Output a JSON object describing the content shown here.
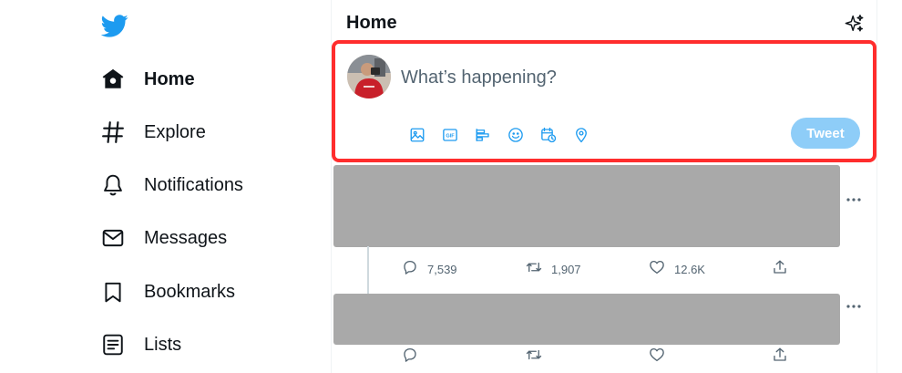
{
  "sidebar": {
    "logo": "twitter-bird-icon",
    "items": [
      {
        "label": "Home",
        "icon": "home-icon",
        "active": true
      },
      {
        "label": "Explore",
        "icon": "hashtag-icon"
      },
      {
        "label": "Notifications",
        "icon": "bell-icon"
      },
      {
        "label": "Messages",
        "icon": "envelope-icon"
      },
      {
        "label": "Bookmarks",
        "icon": "bookmark-icon"
      },
      {
        "label": "Lists",
        "icon": "list-icon"
      }
    ]
  },
  "header": {
    "title": "Home",
    "sparkle_icon": "sparkle-icon"
  },
  "composer": {
    "placeholder": "What’s happening?",
    "value": "",
    "tools": [
      "image-icon",
      "gif-icon",
      "poll-icon",
      "emoji-icon",
      "schedule-icon",
      "location-icon"
    ],
    "tweet_label": "Tweet",
    "highlight_color": "#ff2d2d"
  },
  "feed": [
    {
      "replies": "7,539",
      "retweets": "1,907",
      "likes": "12.6K"
    },
    {
      "replies": "",
      "retweets": "",
      "likes": ""
    }
  ],
  "colors": {
    "accent": "#1d9bf0",
    "tweet_button_disabled": "#8ecdf8",
    "redacted": "#a9a9a9"
  }
}
